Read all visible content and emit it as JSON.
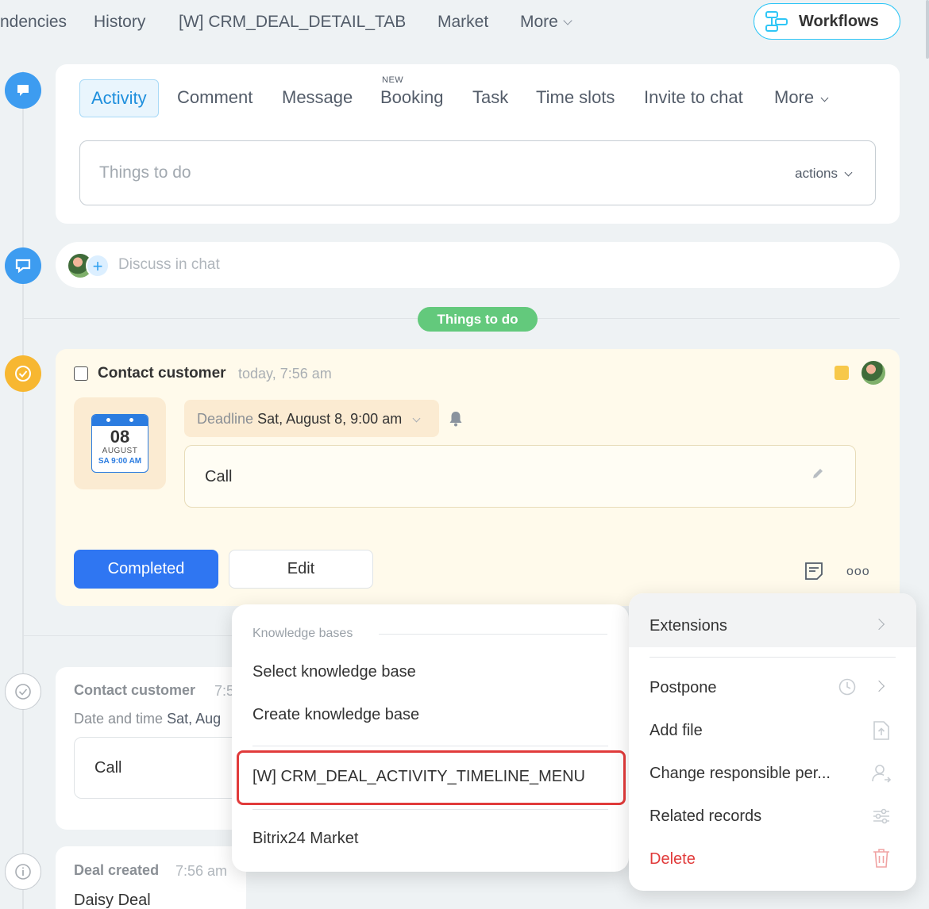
{
  "topnav": {
    "tabs": [
      "ndencies",
      "History",
      "[W] CRM_DEAL_DETAIL_TAB",
      "Market",
      "More"
    ],
    "workflows_label": "Workflows"
  },
  "activity": {
    "tabs": [
      "Activity",
      "Comment",
      "Message",
      "Booking",
      "Task",
      "Time slots",
      "Invite to chat",
      "More"
    ],
    "new_badge": "NEW",
    "input_placeholder": "Things to do",
    "actions_label": "actions"
  },
  "discuss": {
    "placeholder": "Discuss in chat"
  },
  "things_to_do_label": "Things to do",
  "task": {
    "title": "Contact customer",
    "time": "today, 7:56 am",
    "calendar": {
      "day": "08",
      "month": "AUGUST",
      "time": "SA 9:00 AM"
    },
    "deadline_label": "Deadline",
    "deadline_value": "Sat, August 8, 9:00 am",
    "description": "Call",
    "completed_label": "Completed",
    "edit_label": "Edit",
    "dots": "ooo"
  },
  "history_card": {
    "title": "Contact customer",
    "time": "7:5",
    "date_label": "Date and time",
    "date_value": "Sat, Aug",
    "description": "Call"
  },
  "deal_card": {
    "title": "Deal created",
    "time": "7:56 am",
    "name": "Daisy Deal"
  },
  "knowledge_menu": {
    "section_title": "Knowledge bases",
    "items": [
      "Select knowledge base",
      "Create knowledge base",
      "[W] CRM_DEAL_ACTIVITY_TIMELINE_MENU",
      "Bitrix24 Market"
    ]
  },
  "actions_menu": {
    "items": [
      "Extensions",
      "Postpone",
      "Add file",
      "Change responsible per...",
      "Related records",
      "Delete"
    ]
  },
  "colors": {
    "accent_blue": "#2f76f2",
    "pill_green": "#63c97c",
    "highlight_red": "#e13b3b",
    "task_bg": "#fffaeb"
  }
}
